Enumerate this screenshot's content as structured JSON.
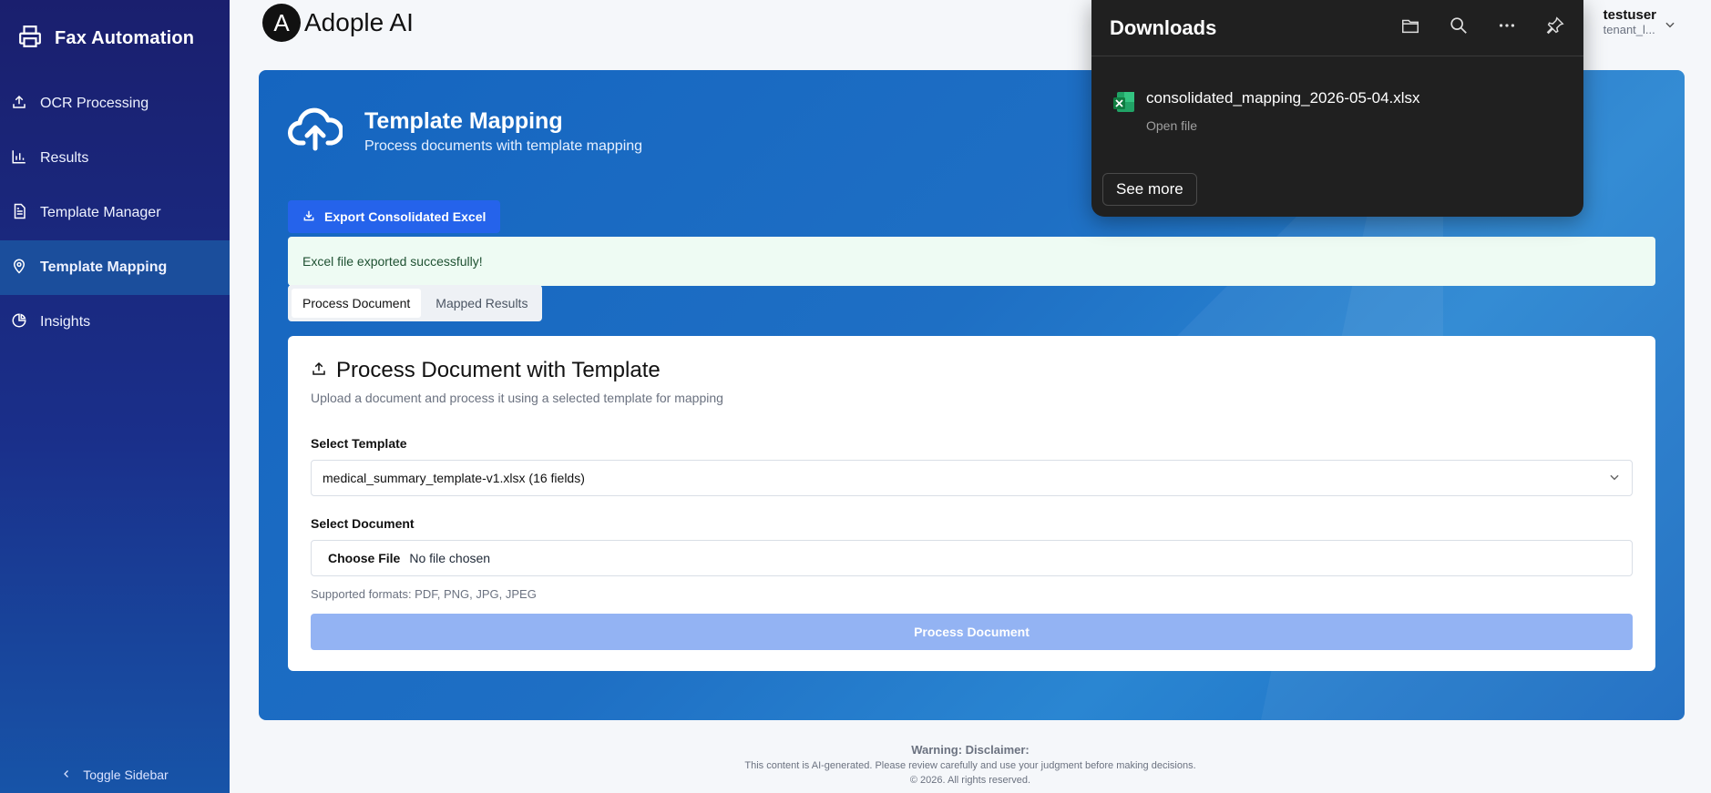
{
  "sidebar": {
    "brand": "Fax Automation",
    "items": [
      {
        "label": "OCR Processing",
        "icon": "upload-icon"
      },
      {
        "label": "Results",
        "icon": "bar-chart-icon"
      },
      {
        "label": "Template Manager",
        "icon": "document-icon"
      },
      {
        "label": "Template Mapping",
        "icon": "map-pin-icon",
        "active": true
      },
      {
        "label": "Insights",
        "icon": "pie-chart-icon"
      }
    ],
    "toggle": "Toggle Sidebar"
  },
  "header": {
    "logo_letter": "A",
    "logo_text": "Adople AI",
    "user_name": "testuser",
    "user_tenant": "tenant_l..."
  },
  "page": {
    "title": "Template Mapping",
    "subtitle": "Process documents with template mapping",
    "export_button": "Export Consolidated Excel",
    "alert": "Excel file exported successfully!",
    "tabs": [
      {
        "label": "Process Document",
        "active": true
      },
      {
        "label": "Mapped Results",
        "active": false
      }
    ]
  },
  "card": {
    "title": "Process Document with Template",
    "subtitle": "Upload a document and process it using a selected template for mapping",
    "template_label": "Select Template",
    "template_value": "medical_summary_template-v1.xlsx (16 fields)",
    "document_label": "Select Document",
    "choose_file": "Choose File",
    "no_file": "No file chosen",
    "formats": "Supported formats: PDF, PNG, JPG, JPEG",
    "process_button": "Process Document"
  },
  "footer": {
    "warning": "Warning: Disclaimer:",
    "line1": "This content is AI-generated. Please review carefully and use your judgment before making decisions.",
    "line2": "© 2026. All rights reserved."
  },
  "downloads": {
    "title": "Downloads",
    "file_name": "consolidated_mapping_2026-05-04.xlsx",
    "open_file": "Open file",
    "see_more": "See more"
  },
  "colors": {
    "sidebar_top": "#1a1f6e",
    "accent": "#2563eb",
    "panel": "#1565c0",
    "success_bg": "#eefbf3",
    "flyout_bg": "#202020"
  }
}
